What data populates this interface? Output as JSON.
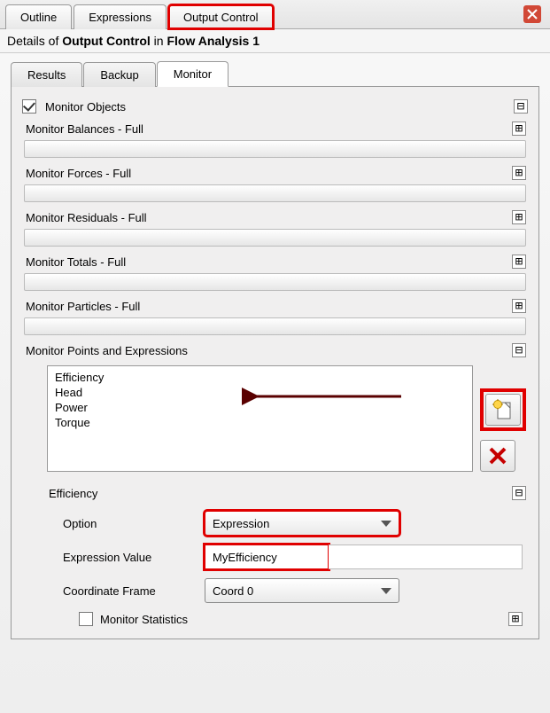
{
  "top_tabs": {
    "outline": "Outline",
    "expressions": "Expressions",
    "output_control": "Output Control"
  },
  "details": {
    "prefix": "Details of ",
    "subject": "Output Control",
    "mid": " in ",
    "context": "Flow Analysis 1"
  },
  "sub_tabs": {
    "results": "Results",
    "backup": "Backup",
    "monitor": "Monitor"
  },
  "monitor_objects": "Monitor Objects",
  "groups": {
    "balances": "Monitor Balances - Full",
    "forces": "Monitor Forces - Full",
    "residuals": "Monitor Residuals - Full",
    "totals": "Monitor Totals - Full",
    "particles": "Monitor Particles - Full",
    "points": "Monitor Points and Expressions"
  },
  "list_items": [
    "Efficiency",
    "Head",
    "Power",
    "Torque"
  ],
  "efficiency_section": {
    "title": "Efficiency",
    "option_label": "Option",
    "option_value": "Expression",
    "expr_label": "Expression Value",
    "expr_value": "MyEfficiency",
    "frame_label": "Coordinate Frame",
    "frame_value": "Coord 0",
    "stats_label": "Monitor Statistics"
  },
  "toggles": {
    "plus": "⊞",
    "minus": "⊟"
  }
}
